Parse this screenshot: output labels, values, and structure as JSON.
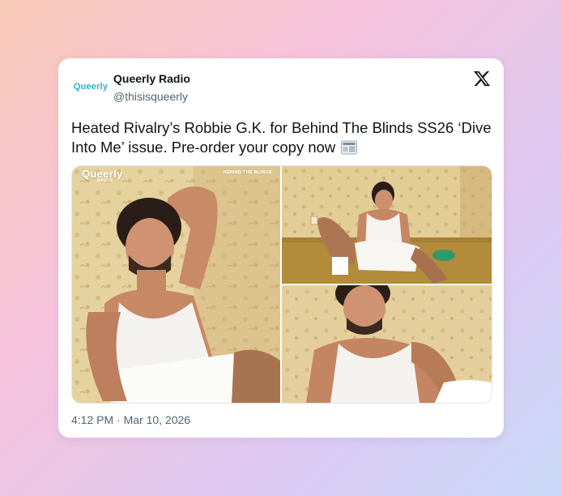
{
  "account": {
    "avatar_text": "Queerly",
    "display_name": "Queerly Radio",
    "handle": "@thisisqueerly"
  },
  "tweet": {
    "text": "Heated Rivalry’s Robbie G.K. for Behind The Blinds SS26 ‘Dive Into Me’ issue. Pre-order your copy now",
    "emoji": "newspaper-emoji",
    "timestamp": "4:12 PM · Mar 10, 2026"
  },
  "media": {
    "photo1": {
      "brand": "Queerly",
      "brand_sub": "RADIO",
      "magazine_title": "BEHIND THE BLINDS"
    },
    "photo2": {},
    "photo3": {}
  },
  "icons": {
    "platform": "x-logo-icon"
  },
  "colors": {
    "brand": "#2bb3c2",
    "text": "#0f1419",
    "muted": "#536471"
  }
}
